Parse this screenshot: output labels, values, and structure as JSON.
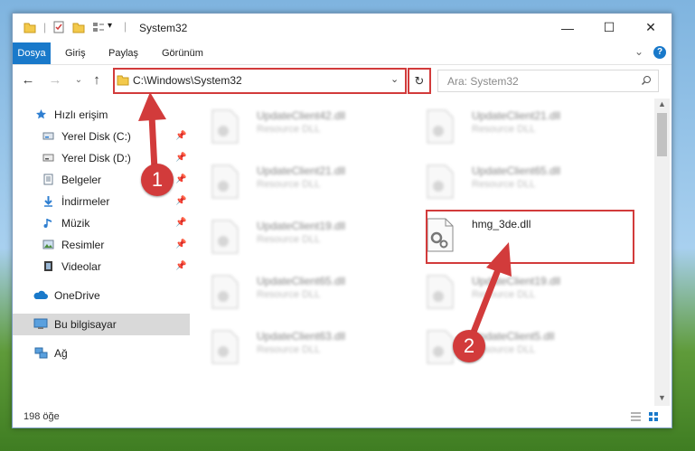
{
  "window": {
    "title": "System32",
    "controls": {
      "minimize": "—",
      "maximize": "☐",
      "close": "✕"
    }
  },
  "ribbon": {
    "tabs": [
      "Dosya",
      "Giriş",
      "Paylaş",
      "Görünüm"
    ],
    "help": "?",
    "expand": "⌄"
  },
  "navigation": {
    "back": "←",
    "forward": "→",
    "recent": "⌄",
    "up": "↑",
    "address": "C:\\Windows\\System32",
    "refresh": "↻",
    "search_placeholder": "Ara: System32"
  },
  "sidebar": {
    "quick_access": "Hızlı erişim",
    "items": [
      {
        "label": "Yerel Disk (C:)",
        "icon": "drive-icon"
      },
      {
        "label": "Yerel Disk (D:)",
        "icon": "drive-icon"
      },
      {
        "label": "Belgeler",
        "icon": "documents-icon"
      },
      {
        "label": "İndirmeler",
        "icon": "downloads-icon"
      },
      {
        "label": "Müzik",
        "icon": "music-icon"
      },
      {
        "label": "Resimler",
        "icon": "pictures-icon"
      },
      {
        "label": "Videolar",
        "icon": "videos-icon"
      }
    ],
    "onedrive": "OneDrive",
    "this_pc": "Bu bilgisayar",
    "network": "Ağ"
  },
  "files": [
    {
      "name": "UpdateClient42.dll",
      "type": "Resource DLL"
    },
    {
      "name": "UpdateClient21.dll",
      "type": "Resource DLL"
    },
    {
      "name": "UpdateClient21.dll",
      "type": "Resource DLL"
    },
    {
      "name": "UpdateClient65.dll",
      "type": "Resource DLL"
    },
    {
      "name": "UpdateClient19.dll",
      "type": "Resource DLL"
    },
    {
      "name": "hmg_3de.dll",
      "type": ""
    },
    {
      "name": "UpdateClient65.dll",
      "type": "Resource DLL"
    },
    {
      "name": "UpdateClient19.dll",
      "type": "Resource DLL"
    },
    {
      "name": "UpdateClient63.dll",
      "type": "Resource DLL"
    },
    {
      "name": "UpdateClient5.dll",
      "type": "Resource DLL"
    }
  ],
  "status": {
    "item_count": "198 öğe"
  },
  "annotations": {
    "step1": "1",
    "step2": "2"
  },
  "colors": {
    "accent": "#1979ca",
    "highlight": "#d23b3b"
  }
}
